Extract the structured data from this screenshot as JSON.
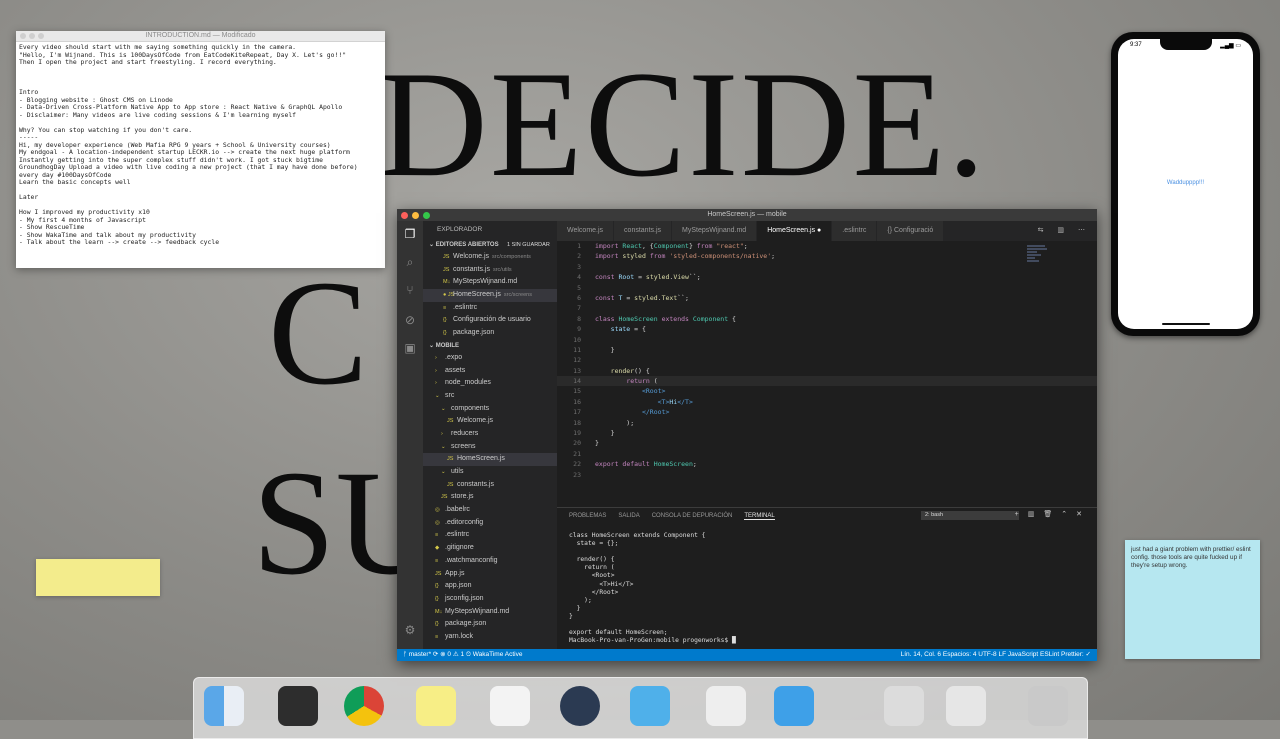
{
  "backdrop": {
    "line1": "DECIDE.",
    "line2": "C",
    "line3": "SU"
  },
  "notes_window": {
    "title": "INTRODUCTION.md — Modificado",
    "body": "Every video should start with me saying something quickly in the camera.\n\"Hello, I'm Wijnand. This is 100DaysOfCode from EatCodeKiteRepeat, Day X. Let's go!!\"\nThen I open the project and start freestyling. I record everything.\n\n\n\nIntro\n- Blogging website : Ghost CMS on Linode\n- Data-Driven Cross-Platform Native App to App store : React Native & GraphQL Apollo\n- Disclaimer: Many videos are live coding sessions & I'm learning myself\n\nWhy? You can stop watching if you don't care.\n-----\nHi, my developer experience (Web Mafia RPG 9 years + School & University courses)\nMy endgoal - A location-independent startup LECKR.io --> create the next huge platform\nInstantly getting into the super complex stuff didn't work. I got stuck bigtime\nGroundhogDay Upload a video with live coding a new project (that I may have done before)\nevery day #100DaysOfCode\nLearn the basic concepts well\n\nLater\n\nHow I improved my productivity x10\n- My first 4 months of Javascript\n- Show RescueTime\n- Show WakaTime and talk about my productivity\n- Talk about the learn --> create --> feedback cycle"
  },
  "phone": {
    "time": "9:37",
    "content_text": "Waddupppp!!!"
  },
  "vscode": {
    "window_title": "HomeScreen.js — mobile",
    "sidebar": {
      "header": "EXPLORADOR",
      "open_editors_label": "EDITORES ABIERTOS",
      "unsaved_badge": "1 SIN GUARDAR",
      "open_editors": [
        {
          "name": "Welcome.js",
          "path": "src/components",
          "icon": "JS"
        },
        {
          "name": "constants.js",
          "path": "src/utils",
          "icon": "JS"
        },
        {
          "name": "MyStepsWijnand.md",
          "path": "",
          "icon": "M↓"
        },
        {
          "name": "HomeScreen.js",
          "path": "src/screens",
          "icon": "● JS"
        },
        {
          "name": ".eslintrc",
          "path": "",
          "icon": "≡"
        },
        {
          "name": "Configuración de usuario",
          "path": "",
          "icon": "{}"
        },
        {
          "name": "package.json",
          "path": "",
          "icon": "{}"
        }
      ],
      "project_label": "MOBILE",
      "tree": [
        {
          "name": ".expo",
          "icon": "›",
          "indent": 1
        },
        {
          "name": "assets",
          "icon": "›",
          "indent": 1
        },
        {
          "name": "node_modules",
          "icon": "›",
          "indent": 1
        },
        {
          "name": "src",
          "icon": "⌄",
          "indent": 1
        },
        {
          "name": "components",
          "icon": "⌄",
          "indent": 2
        },
        {
          "name": "Welcome.js",
          "icon": "JS",
          "indent": 3
        },
        {
          "name": "reducers",
          "icon": "›",
          "indent": 2
        },
        {
          "name": "screens",
          "icon": "⌄",
          "indent": 2
        },
        {
          "name": "HomeScreen.js",
          "icon": "JS",
          "indent": 3,
          "selected": true
        },
        {
          "name": "utils",
          "icon": "⌄",
          "indent": 2
        },
        {
          "name": "constants.js",
          "icon": "JS",
          "indent": 3
        },
        {
          "name": "store.js",
          "icon": "JS",
          "indent": 2
        },
        {
          "name": ".babelrc",
          "icon": "◎",
          "indent": 1
        },
        {
          "name": ".editorconfig",
          "icon": "◎",
          "indent": 1
        },
        {
          "name": ".eslintrc",
          "icon": "≡",
          "indent": 1
        },
        {
          "name": ".gitignore",
          "icon": "◆",
          "indent": 1
        },
        {
          "name": ".watchmanconfig",
          "icon": "≡",
          "indent": 1
        },
        {
          "name": "App.js",
          "icon": "JS",
          "indent": 1
        },
        {
          "name": "app.json",
          "icon": "{}",
          "indent": 1
        },
        {
          "name": "jsconfig.json",
          "icon": "{}",
          "indent": 1
        },
        {
          "name": "MyStepsWijnand.md",
          "icon": "M↓",
          "indent": 1
        },
        {
          "name": "package.json",
          "icon": "{}",
          "indent": 1
        },
        {
          "name": "yarn.lock",
          "icon": "≡",
          "indent": 1
        }
      ]
    },
    "tabs": [
      {
        "label": "Welcome.js",
        "active": false
      },
      {
        "label": "constants.js",
        "active": false
      },
      {
        "label": "MyStepsWijnand.md",
        "active": false
      },
      {
        "label": "HomeScreen.js ●",
        "active": true
      },
      {
        "label": ".eslintrc",
        "active": false
      },
      {
        "label": "{} Configuració",
        "active": false
      }
    ],
    "code_lines": [
      "import React, {Component} from \"react\";",
      "import styled from 'styled-components/native';",
      "",
      "const Root = styled.View``;",
      "",
      "const T = styled.Text``;",
      "",
      "class HomeScreen extends Component {",
      "    state = {",
      "",
      "    }",
      "",
      "    render() {",
      "        return (",
      "            <Root>",
      "                <T>Hi</T>",
      "            </Root>",
      "        );",
      "    }",
      "}",
      "",
      "export default HomeScreen;",
      ""
    ],
    "panel": {
      "tabs": [
        "PROBLEMAS",
        "SALIDA",
        "CONSOLA DE DEPURACIÓN",
        "TERMINAL"
      ],
      "active_tab": "TERMINAL",
      "terminal_select": "2: bash",
      "terminal_text": "class HomeScreen extends Component {\n  state = {};\n\n  render() {\n    return (\n      <Root>\n        <T>Hi</T>\n      </Root>\n    );\n  }\n}\n\nexport default HomeScreen;\nMacBook-Pro-van-ProGen:mobile progenworks$ █"
    },
    "status": {
      "left": "ᚠ master*   ⟳   ⊗ 0 ⚠ 1   ⏲ WakaTime Active",
      "right": "Lín. 14, Col. 6     Espacios: 4     UTF-8     LF     JavaScript     ESLint     Prettier: ✓"
    }
  },
  "sticky_blue": {
    "text": "just had a giant problem with prettier/ eslint config. those tools are quite fucked up if they're setup wrong."
  },
  "colors": {
    "vscode_accent": "#007acc",
    "sticky_yellow": "#f3ec8c",
    "sticky_blue": "#b6e7f0"
  }
}
